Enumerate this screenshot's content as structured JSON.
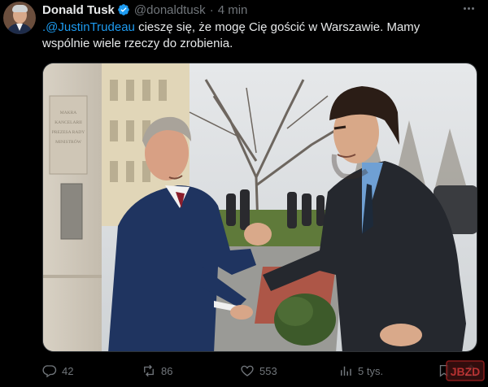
{
  "author": {
    "name": "Donald Tusk",
    "handle": "@donaldtusk",
    "separator": "·",
    "time": "4 min",
    "verified": true
  },
  "tweet": {
    "mention": ".@JustinTrudeau",
    "text": " cieszę się, że mogę Cię gościć w Warszawie. Mamy wspólnie wiele rzeczy do zrobienia."
  },
  "media": {
    "plaque_text": [
      "MAKRA",
      "KANCELARII",
      "PREZESA RADY",
      "MINISTRÓW"
    ]
  },
  "actions": {
    "replies": "42",
    "reposts": "86",
    "likes": "553",
    "views": "5 tys."
  },
  "colors": {
    "background": "#000000",
    "text": "#e7e9ea",
    "muted": "#71767b",
    "link": "#1d9bf0",
    "verified": "#1d9bf0"
  },
  "icons": {
    "more": "more-icon",
    "verified": "verified-badge-icon",
    "reply": "reply-icon",
    "repost": "repost-icon",
    "like": "heart-icon",
    "views": "views-icon",
    "bookmark": "bookmark-icon",
    "share": "share-icon"
  },
  "watermark": "JBZD"
}
